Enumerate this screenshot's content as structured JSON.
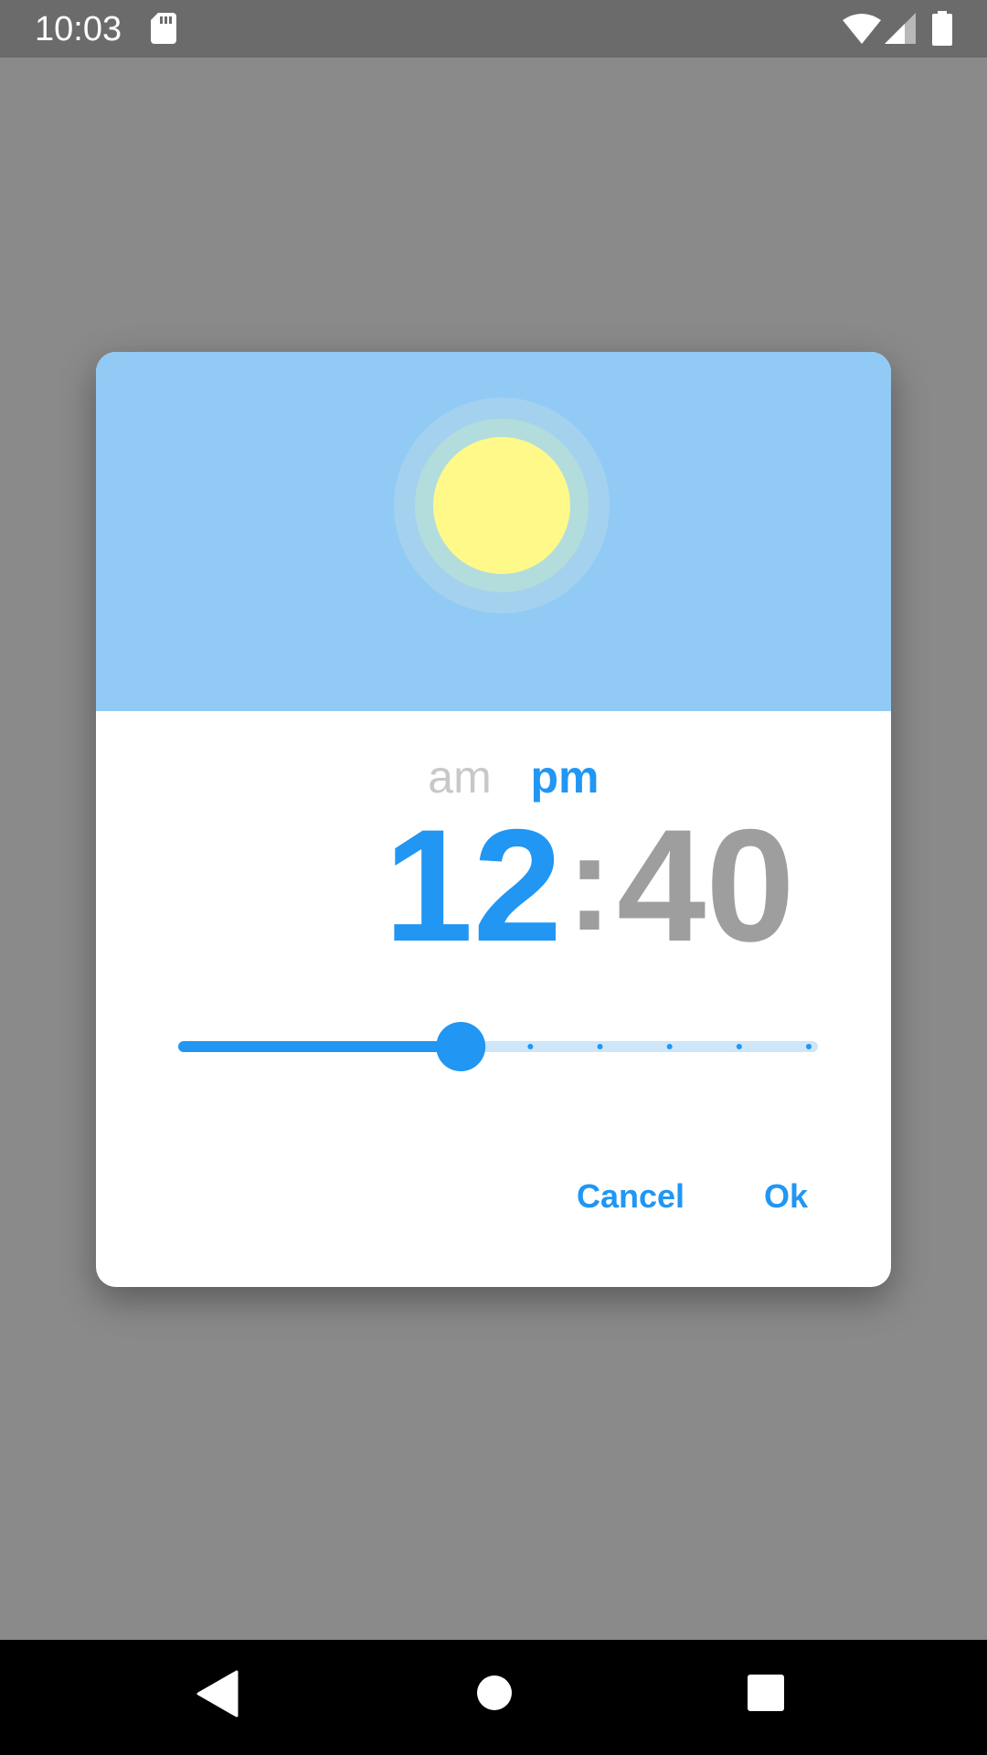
{
  "status_bar": {
    "time": "10:03",
    "icons": [
      "sd-card-icon",
      "wifi-icon",
      "signal-icon",
      "battery-icon"
    ]
  },
  "dialog": {
    "header": {
      "icon": "sun-icon",
      "sky_color": "#92caf6",
      "sun_color": "#fff98a"
    },
    "period": {
      "am_label": "am",
      "pm_label": "pm",
      "selected": "pm"
    },
    "time": {
      "hour": "12",
      "separator": ":",
      "minute": "40",
      "active_part": "hour"
    },
    "slider": {
      "value_fraction": 0.44,
      "steps_after_thumb": 5
    },
    "actions": {
      "cancel_label": "Cancel",
      "ok_label": "Ok"
    },
    "accent_color": "#2196f3",
    "muted_color": "#9e9e9e"
  },
  "nav_bar": {
    "icons": [
      "back-icon",
      "home-icon",
      "recents-icon"
    ]
  }
}
